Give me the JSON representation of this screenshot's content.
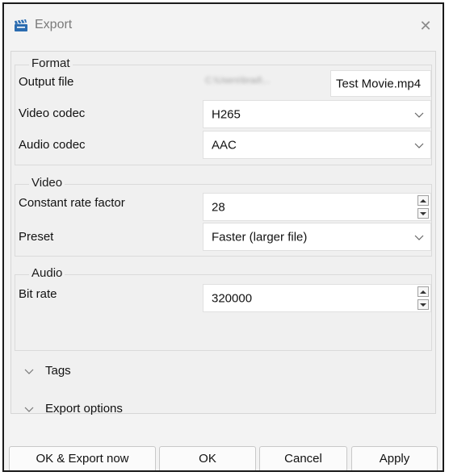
{
  "window": {
    "title": "Export",
    "close_glyph": "✕"
  },
  "format": {
    "group_title": "Format",
    "output_file_label": "Output file",
    "output_path_blurred": "C:\\Users\\brad\\...",
    "output_file_value": "Test Movie.mp4",
    "video_codec_label": "Video codec",
    "video_codec_value": "H265",
    "audio_codec_label": "Audio codec",
    "audio_codec_value": "AAC"
  },
  "video": {
    "group_title": "Video",
    "crf_label": "Constant rate factor",
    "crf_value": "28",
    "preset_label": "Preset",
    "preset_value": "Faster (larger file)"
  },
  "audio": {
    "group_title": "Audio",
    "bitrate_label": "Bit rate",
    "bitrate_value": "320000"
  },
  "sections": {
    "tags": "Tags",
    "export_options": "Export options"
  },
  "buttons": {
    "ok_export_now": "OK & Export now",
    "ok": "OK",
    "cancel": "Cancel",
    "apply": "Apply"
  },
  "icons": {
    "app": "clapperboard-icon",
    "close": "close-icon",
    "dropdown": "chevron-down-icon",
    "section": "chevron-down-icon",
    "spin_up": "spin-up-icon",
    "spin_down": "spin-down-icon"
  },
  "colors": {
    "app_icon": "#2b6cb0",
    "background": "#f3f3f3",
    "field_background": "#ffffff"
  }
}
